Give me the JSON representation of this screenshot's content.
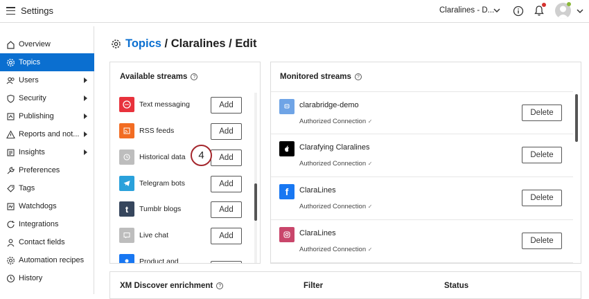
{
  "header": {
    "title": "Settings",
    "org_name": "Claralines - D...",
    "icons": [
      "menu-icon",
      "chevron-down-icon",
      "info-icon",
      "bell-icon",
      "avatar"
    ]
  },
  "sidebar": {
    "items": [
      {
        "label": "Overview",
        "icon": "home-icon",
        "has_submenu": false,
        "active": false
      },
      {
        "label": "Topics",
        "icon": "gear-icon",
        "has_submenu": false,
        "active": true
      },
      {
        "label": "Users",
        "icon": "users-icon",
        "has_submenu": true,
        "active": false
      },
      {
        "label": "Security",
        "icon": "shield-icon",
        "has_submenu": true,
        "active": false
      },
      {
        "label": "Publishing",
        "icon": "publish-icon",
        "has_submenu": true,
        "active": false
      },
      {
        "label": "Reports and not...",
        "icon": "warning-icon",
        "has_submenu": true,
        "active": false
      },
      {
        "label": "Insights",
        "icon": "insights-icon",
        "has_submenu": true,
        "active": false
      },
      {
        "label": "Preferences",
        "icon": "wrench-icon",
        "has_submenu": false,
        "active": false
      },
      {
        "label": "Tags",
        "icon": "tag-icon",
        "has_submenu": false,
        "active": false
      },
      {
        "label": "Watchdogs",
        "icon": "watchdog-icon",
        "has_submenu": false,
        "active": false
      },
      {
        "label": "Integrations",
        "icon": "refresh-icon",
        "has_submenu": false,
        "active": false
      },
      {
        "label": "Contact fields",
        "icon": "person-icon",
        "has_submenu": false,
        "active": false
      },
      {
        "label": "Automation recipes",
        "icon": "automation-icon",
        "has_submenu": false,
        "active": false
      },
      {
        "label": "History",
        "icon": "clock-icon",
        "has_submenu": false,
        "active": false
      }
    ],
    "accent": "#0b6fd0"
  },
  "breadcrumb": {
    "link": "Topics",
    "rest": " / Claralines / Edit"
  },
  "available_streams": {
    "title": "Available streams",
    "add_label": "Add",
    "items": [
      {
        "label": "Text messaging",
        "icon": "text-messaging-icon",
        "color": "#e8323c"
      },
      {
        "label": "RSS feeds",
        "icon": "rss-icon",
        "color": "#f26c22"
      },
      {
        "label": "Historical data",
        "icon": "history-icon",
        "color": "#bdbdbd"
      },
      {
        "label": "Telegram bots",
        "icon": "telegram-icon",
        "color": "#2aa1db"
      },
      {
        "label": "Tumblr blogs",
        "icon": "tumblr-icon",
        "color": "#36465d"
      },
      {
        "label": "Live chat",
        "icon": "chat-icon",
        "color": "#bdbdbd"
      },
      {
        "label": "Product and",
        "icon": "product-icon",
        "color": "#1877f2"
      }
    ]
  },
  "callout": {
    "number": "4"
  },
  "monitored_streams": {
    "title": "Monitored streams",
    "delete_label": "Delete",
    "items": [
      {
        "name": "clarabridge-demo",
        "status": "Authorized Connection",
        "icon": "clarabridge-icon",
        "color": "#6fa4e6"
      },
      {
        "name": "Clarafying Claralines",
        "status": "Authorized Connection",
        "icon": "apple-icon",
        "color": "#000000"
      },
      {
        "name": "ClaraLines",
        "status": "Authorized Connection",
        "icon": "facebook-icon",
        "color": "#1877f2"
      },
      {
        "name": "ClaraLines",
        "status": "Authorized Connection",
        "icon": "instagram-icon",
        "color": "#c9466b"
      }
    ]
  },
  "enrichment": {
    "title": "XM Discover enrichment",
    "col_filter": "Filter",
    "col_status": "Status"
  }
}
